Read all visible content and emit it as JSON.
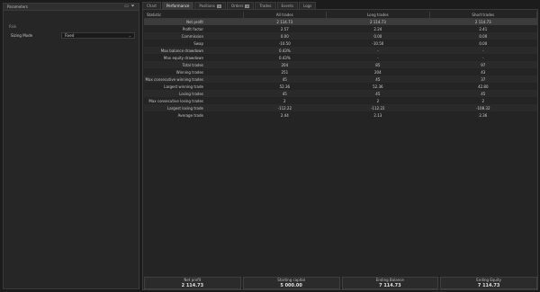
{
  "panel": {
    "title": "Parameters",
    "section": "Risk",
    "param_label": "Sizing Mode",
    "param_value": "Fixed"
  },
  "tabs": [
    {
      "label": "Chart",
      "badge": ""
    },
    {
      "label": "Performance",
      "badge": ""
    },
    {
      "label": "Positions",
      "badge": "0"
    },
    {
      "label": "Orders",
      "badge": "0"
    },
    {
      "label": "Trades",
      "badge": ""
    },
    {
      "label": "Events",
      "badge": ""
    },
    {
      "label": "Logs",
      "badge": ""
    }
  ],
  "table": {
    "headers": [
      "Statistic",
      "All trades",
      "Long trades",
      "Short trades"
    ],
    "rows": [
      [
        "Net profit",
        "2 114.73",
        "2 114.73",
        "2 114.73"
      ],
      [
        "Profit factor",
        "2.57",
        "2.24",
        "2.41"
      ],
      [
        "Commission",
        "0.00",
        "0.00",
        "0.00"
      ],
      [
        "Swap",
        "-10.50",
        "-10.50",
        "0.00"
      ],
      [
        "Max balance drawdown",
        "0.43%",
        "-",
        "-"
      ],
      [
        "Max equity drawdown",
        "0.43%",
        "-",
        "-"
      ],
      [
        "Total trades",
        "204",
        "85",
        "97"
      ],
      [
        "Winning trades",
        "251",
        "204",
        "43"
      ],
      [
        "Max consecutive winning trades",
        "45",
        "45",
        "37"
      ],
      [
        "Largest winning trade",
        "52.36",
        "52.36",
        "42.80"
      ],
      [
        "Losing trades",
        "45",
        "45",
        "45"
      ],
      [
        "Max consecutive losing trades",
        "2",
        "2",
        "2"
      ],
      [
        "Largest losing trade",
        "-112.22",
        "-112.22",
        "-108.32"
      ],
      [
        "Average trade",
        "2.44",
        "2.13",
        "2.36"
      ]
    ]
  },
  "summary": [
    {
      "label": "Net profit",
      "value": "2 114.73"
    },
    {
      "label": "Starting capital",
      "value": "5 000.00"
    },
    {
      "label": "Ending Balance",
      "value": "7 114.73"
    },
    {
      "label": "Ending Equity",
      "value": "7 114.73"
    }
  ]
}
